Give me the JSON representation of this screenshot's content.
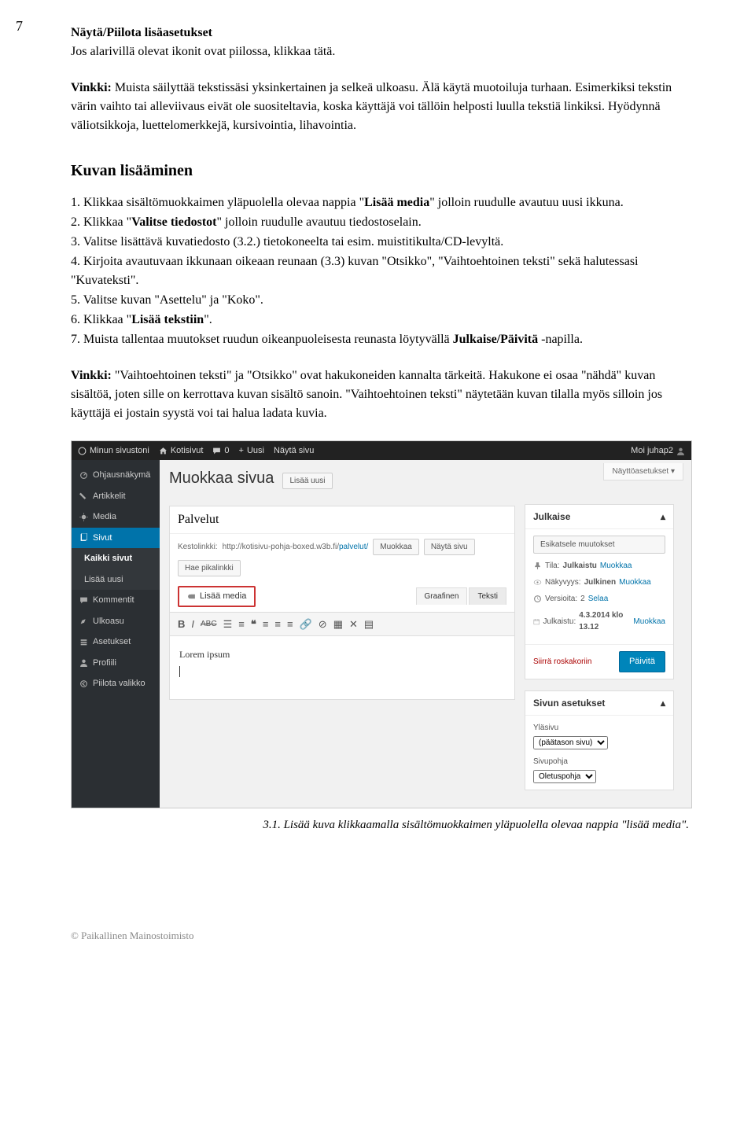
{
  "page_number": "7",
  "sec1": {
    "title": "Näytä/Piilota lisäasetukset",
    "p1": "Jos alarivillä olevat ikonit ovat piilossa, klikkaa tätä.",
    "p2_lead": "Vinkki:",
    "p2": " Muista säilyttää tekstissäsi yksinkertainen ja selkeä ulkoasu. Älä käytä muotoiluja turhaan. Esimerkiksi tekstin värin vaihto tai alleviivaus eivät ole suositeltavia, koska käyttäjä voi tällöin helposti luulla tekstiä linkiksi. Hyödynnä väliotsikkoja, luettelomerkkejä, kursivointia, lihavointia."
  },
  "sec2": {
    "title": "Kuvan lisääminen",
    "li1a": "1. Klikkaa sisältömuokkaimen yläpuolella olevaa nappia \"",
    "li1b": "Lisää media",
    "li1c": "\" jolloin ruudulle avautuu uusi ikkuna.",
    "li2a": "2. Klikkaa \"",
    "li2b": "Valitse tiedostot",
    "li2c": "\" jolloin ruudulle avautuu tiedostoselain.",
    "li3": "3. Valitse lisättävä kuvatiedosto (3.2.) tietokoneelta tai esim. muistitikulta/CD-levyltä.",
    "li4": "4. Kirjoita avautuvaan ikkunaan oikeaan reunaan (3.3) kuvan \"Otsikko\", \"Vaihtoehtoinen teksti\" sekä halutessasi \"Kuvateksti\".",
    "li5": "5. Valitse kuvan \"Asettelu\" ja \"Koko\".",
    "li6a": "6. Klikkaa \"",
    "li6b": "Lisää tekstiin",
    "li6c": "\".",
    "li7a": "7. Muista tallentaa muutokset ruudun oikeanpuoleisesta reunasta löytyvällä ",
    "li7b": "Julkaise/Päivitä",
    "li7c": " -napilla.",
    "tip_lead": "Vinkki:",
    "tip": " \"Vaihtoehtoinen teksti\" ja \"Otsikko\" ovat hakukoneiden kannalta tärkeitä. Hakukone ei osaa \"nähdä\" kuvan sisältöä, joten sille on kerrottava kuvan sisältö sanoin. \"Vaihtoehtoinen teksti\" näytetään kuvan tilalla myös silloin jos käyttäjä ei jostain syystä voi tai halua ladata kuvia."
  },
  "wp": {
    "topbar": {
      "mysite": "Minun sivustoni",
      "home": "Kotisivut",
      "comments": "0",
      "new": "Uusi",
      "view": "Näytä sivu",
      "greeting": "Moi juhap2"
    },
    "side": {
      "dashboard": "Ohjausnäkymä",
      "posts": "Artikkelit",
      "media": "Media",
      "pages": "Sivut",
      "all_pages": "Kaikki sivut",
      "add_new": "Lisää uusi",
      "comments": "Kommentit",
      "appearance": "Ulkoasu",
      "settings": "Asetukset",
      "profile": "Profiili",
      "collapse": "Piilota valikko"
    },
    "main": {
      "h": "Muokkaa sivua",
      "add_new": "Lisää uusi",
      "display_opts": "Näyttöasetukset ▾",
      "title_value": "Palvelut",
      "permalink_label": "Kestolinkki:",
      "permalink_base": "http://kotisivu-pohja-boxed.w3b.fi/",
      "permalink_slug": "palvelut/",
      "edit": "Muokkaa",
      "view_page": "Näytä sivu",
      "shortlink": "Hae pikalinkki",
      "add_media": "Lisää media",
      "tab_visual": "Graafinen",
      "tab_text": "Teksti",
      "content": "Lorem ipsum"
    },
    "publish": {
      "h": "Julkaise",
      "preview": "Esikatsele muutokset",
      "status_l": "Tila:",
      "status_v": "Julkaistu",
      "vis_l": "Näkyvyys:",
      "vis_v": "Julkinen",
      "rev_l": "Versioita:",
      "rev_v": "2",
      "rev_a": "Selaa",
      "pub_l": "Julkaistu:",
      "pub_v": "4.3.2014 klo 13.12",
      "edit": "Muokkaa",
      "trash": "Siirrä roskakoriin",
      "update": "Päivitä"
    },
    "attrs": {
      "h": "Sivun asetukset",
      "parent_l": "Yläsivu",
      "parent_v": "(päätason sivu)",
      "tmpl_l": "Sivupohja",
      "tmpl_v": "Oletuspohja"
    }
  },
  "caption": "3.1. Lisää kuva klikkaamalla sisältömuokkaimen yläpuolella olevaa nappia \"lisää media\".",
  "footer": "© Paikallinen Mainostoimisto"
}
